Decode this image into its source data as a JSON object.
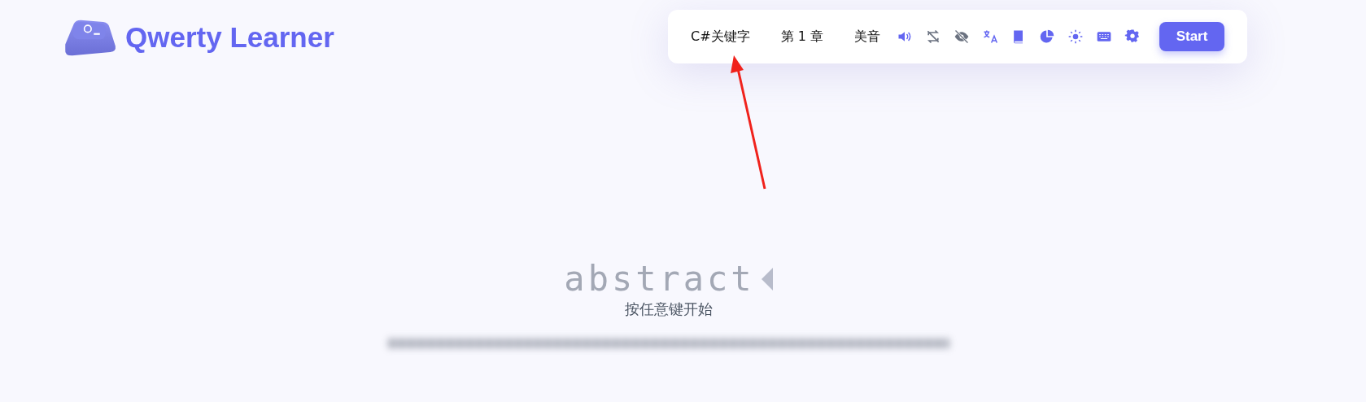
{
  "header": {
    "title": "Qwerty Learner"
  },
  "toolbar": {
    "dictionary": "C#关键字",
    "chapter": "第 1 章",
    "pronunciation": "美音",
    "icons": [
      {
        "kind": "sound",
        "on": true
      },
      {
        "kind": "loop",
        "on": false
      },
      {
        "kind": "visibility",
        "on": false
      },
      {
        "kind": "translate",
        "on": true
      },
      {
        "kind": "book",
        "on": true
      },
      {
        "kind": "chart",
        "on": true
      },
      {
        "kind": "sun",
        "on": true
      },
      {
        "kind": "keyboard",
        "on": true
      },
      {
        "kind": "settings",
        "on": true
      }
    ],
    "start_button": "Start"
  },
  "word": {
    "text": "abstract"
  },
  "prompt": "按任意键开始"
}
